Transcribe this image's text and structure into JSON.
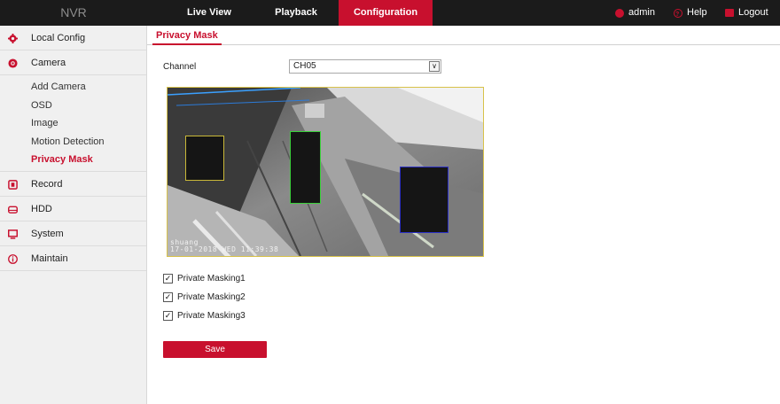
{
  "brand": "NVR",
  "nav": {
    "items": [
      "Live View",
      "Playback",
      "Configuration"
    ],
    "active_index": 2
  },
  "tools": {
    "user": "admin",
    "help": "Help",
    "logout": "Logout"
  },
  "sidebar": {
    "local_config": "Local Config",
    "camera": "Camera",
    "camera_sub": [
      "Add Camera",
      "OSD",
      "Image",
      "Motion Detection",
      "Privacy Mask"
    ],
    "active_sub": "Privacy Mask",
    "record": "Record",
    "hdd": "HDD",
    "system": "System",
    "maintain": "Maintain"
  },
  "main": {
    "tab": "Privacy Mask",
    "channel_label": "Channel",
    "channel_value": "CH05",
    "osd_name": "shuang",
    "osd_datetime": "17-01-2018 WED 11:39:38",
    "masks": [
      {
        "label": "Private Masking1",
        "checked": true,
        "color": "#c9b838"
      },
      {
        "label": "Private Masking2",
        "checked": true,
        "color": "#3bd13b"
      },
      {
        "label": "Private Masking3",
        "checked": true,
        "color": "#2b2fc6"
      }
    ],
    "save_label": "Save"
  },
  "colors": {
    "accent": "#c8102e",
    "topbar": "#1b1b1b",
    "sidebar_bg": "#f0f0f0"
  }
}
